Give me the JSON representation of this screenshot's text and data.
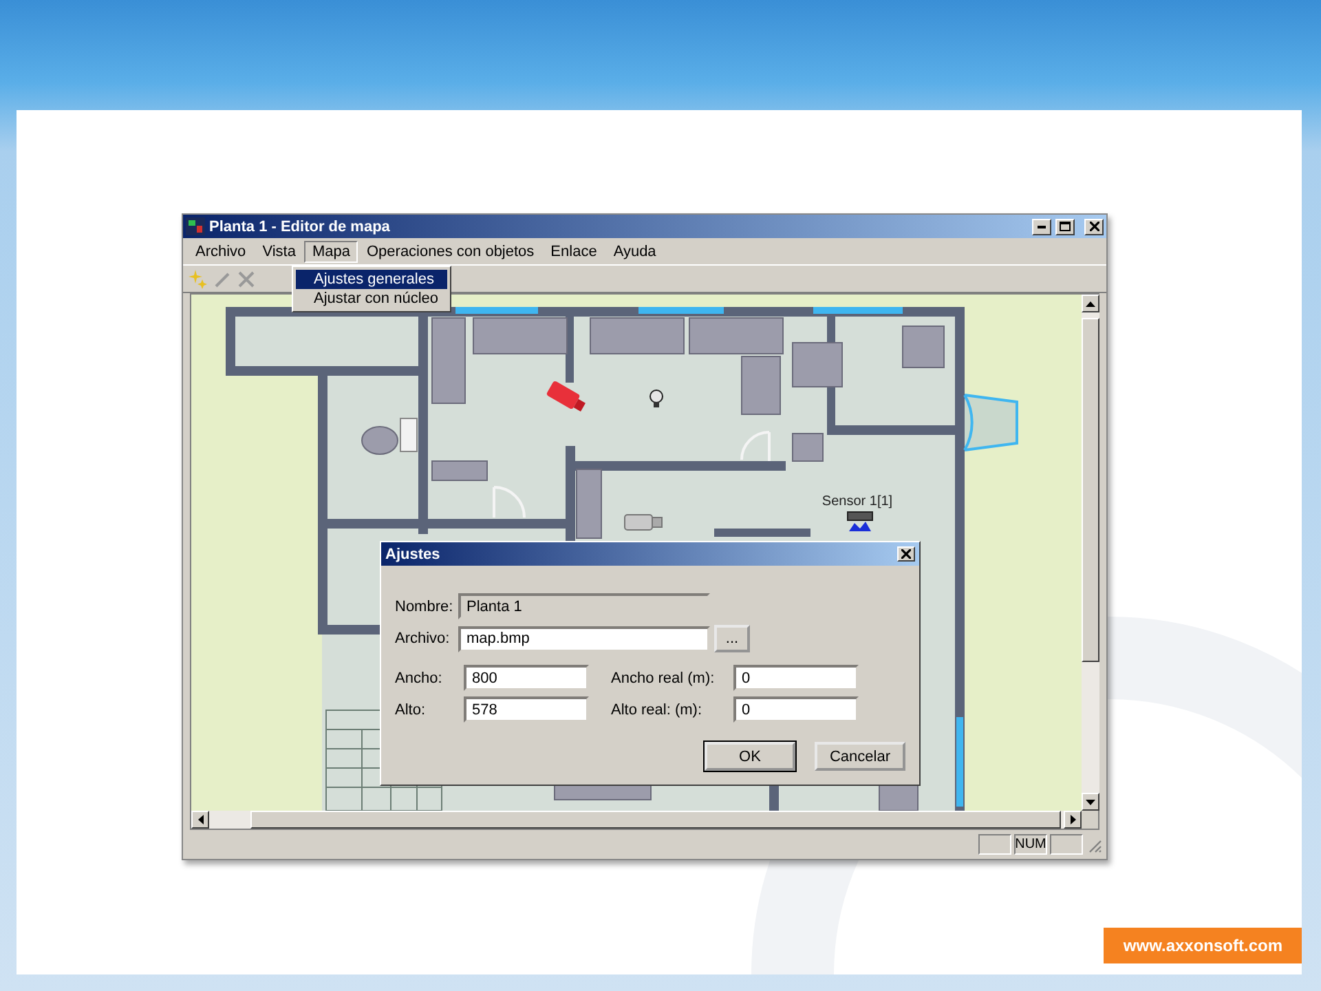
{
  "window": {
    "title": "Planta 1 - Editor de mapa",
    "menu": [
      {
        "label": "Archivo",
        "selected": false
      },
      {
        "label": "Vista",
        "selected": false
      },
      {
        "label": "Mapa",
        "selected": true
      },
      {
        "label": "Operaciones con objetos",
        "selected": false
      },
      {
        "label": "Enlace",
        "selected": false
      },
      {
        "label": "Ayuda",
        "selected": false
      }
    ],
    "dropdown": [
      {
        "label": "Ajustes generales",
        "selected": true
      },
      {
        "label": "Ajustar con núcleo",
        "selected": false
      }
    ],
    "map": {
      "sensor_label": "Sensor 1[1]"
    },
    "status_bar": {
      "indicator": "NUM"
    }
  },
  "dialog": {
    "title": "Ajustes",
    "file_fields": [
      {
        "label": "Nombre:",
        "value": "Planta 1",
        "disabled": true
      },
      {
        "label": "Archivo:",
        "value": "map.bmp",
        "disabled": false
      }
    ],
    "browse_button": "...",
    "size_fields": [
      {
        "label": "Ancho:",
        "value": "800",
        "disabled": false
      },
      {
        "label": "Ancho real (m):",
        "value": "0",
        "disabled": false
      },
      {
        "label": "Alto:",
        "value": "578",
        "disabled": false
      },
      {
        "label": "Alto real: (m):",
        "value": "0",
        "disabled": false
      }
    ],
    "buttons": [
      {
        "label": "OK",
        "default": true
      },
      {
        "label": "Cancelar",
        "default": false
      }
    ]
  },
  "slide": {
    "footer_link": "www.axxonsoft.com"
  }
}
